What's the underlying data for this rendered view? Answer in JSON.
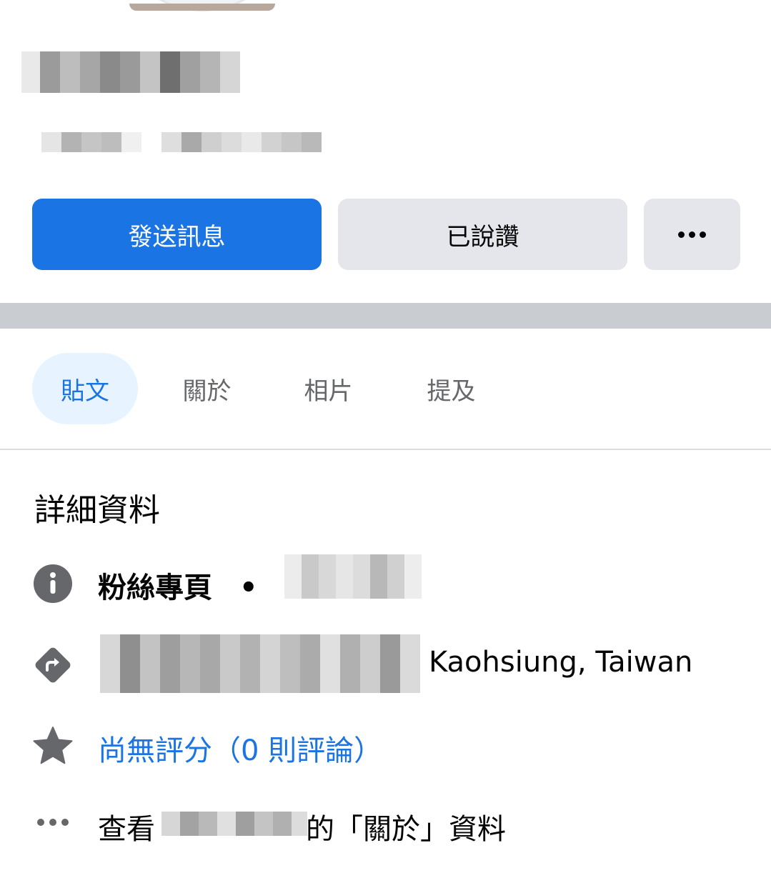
{
  "actions": {
    "message_label": "發送訊息",
    "liked_label": "已說讚",
    "more_icon": "more-dots-icon"
  },
  "tabs": [
    {
      "label": "貼文",
      "active": true
    },
    {
      "label": "關於",
      "active": false
    },
    {
      "label": "相片",
      "active": false
    },
    {
      "label": "提及",
      "active": false
    }
  ],
  "details": {
    "title": "詳細資料",
    "category_label": "粉絲專頁",
    "category_separator": "•",
    "address_suffix": "Kaohsiung, Taiwan",
    "rating_text": "尚無評分（0 則評論）",
    "about_prefix": "查看",
    "about_suffix": "的「關於」資料"
  },
  "colors": {
    "primary": "#1b74e4",
    "secondary_button": "#e4e6eb",
    "active_tab_bg": "#e7f3ff",
    "icon_gray": "#65676b"
  }
}
